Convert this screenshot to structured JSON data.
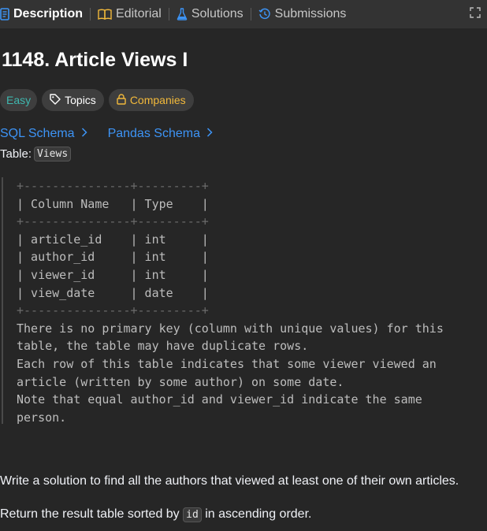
{
  "tabs": [
    {
      "label": "Description",
      "icon": "description-icon",
      "active": true
    },
    {
      "label": "Editorial",
      "icon": "book-icon",
      "active": false
    },
    {
      "label": "Solutions",
      "icon": "flask-icon",
      "active": false
    },
    {
      "label": "Submissions",
      "icon": "history-icon",
      "active": false
    }
  ],
  "problem": {
    "title": "1148. Article Views I",
    "difficulty": "Easy",
    "topics_label": "Topics",
    "companies_label": "Companies",
    "schema_links": [
      "SQL Schema",
      "Pandas Schema"
    ],
    "table_prefix": "Table:",
    "table_name": "Views",
    "schema_block": {
      "border_top": "+---------------+---------+",
      "header": "| Column Name   | Type    |",
      "rows": [
        "| article_id    | int     |",
        "| author_id     | int     |",
        "| viewer_id     | int     |",
        "| view_date     | date    |"
      ],
      "notes": [
        "There is no primary key (column with unique values) for this",
        "table, the table may have duplicate rows.",
        "Each row of this table indicates that some viewer viewed an",
        "article (written by some author) on some date.",
        "Note that equal author_id and viewer_id indicate the same",
        "person."
      ]
    },
    "task": "Write a solution to find all the authors that viewed at least one of their own articles.",
    "return_prefix": "Return the result table sorted by",
    "return_code": "id",
    "return_suffix": "in ascending order."
  },
  "colors": {
    "background": "#262626",
    "tabbar": "#333333",
    "easy": "#3fb8af",
    "companies": "#f2b93b",
    "link": "#3d94f6"
  }
}
